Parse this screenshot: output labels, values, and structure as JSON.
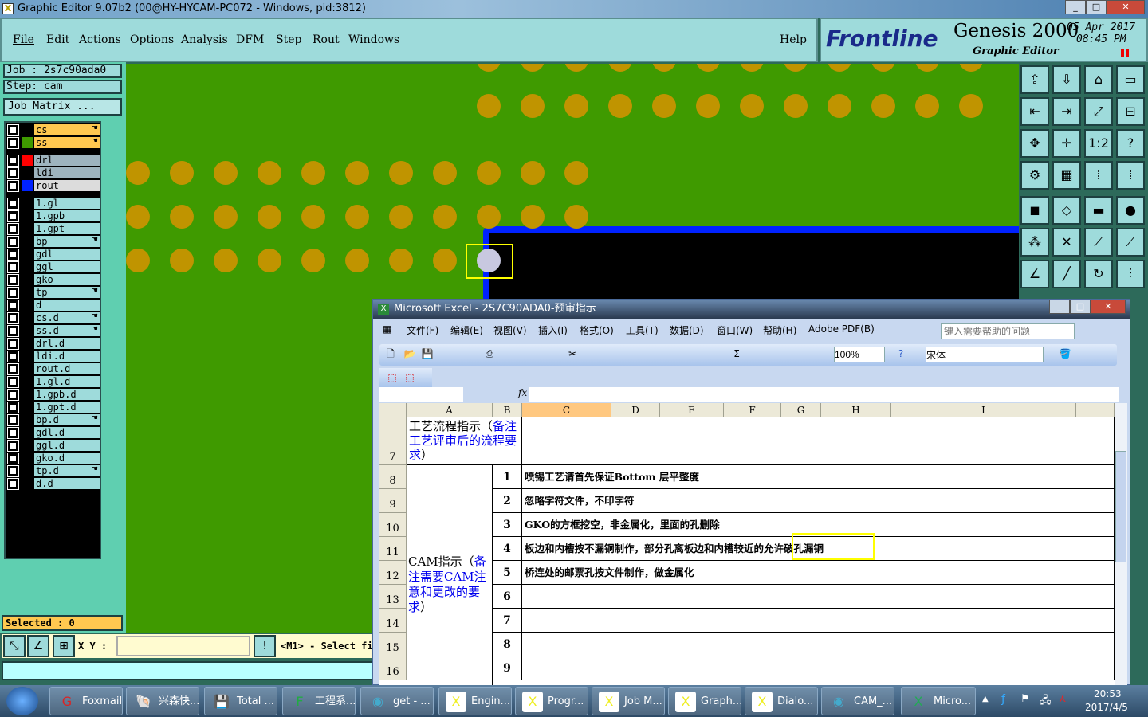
{
  "window": {
    "title": "Graphic Editor 9.07b2 (00@HY-HYCAM-PC072 - Windows, pid:3812)"
  },
  "menu": [
    "File",
    "Edit",
    "Actions",
    "Options",
    "Analysis",
    "DFM",
    "Step",
    "Rout",
    "Windows"
  ],
  "help": "Help",
  "brand": {
    "logo": "Frontline",
    "product": "Genesis 2000",
    "subtitle": "Graphic Editor",
    "date": "05 Apr 2017",
    "time": "08:45 PM"
  },
  "job": {
    "job": "Job : 2s7c90ada0",
    "step": "Step: cam",
    "matrix": "Job Matrix ..."
  },
  "layers": [
    {
      "name": "cs",
      "color": "#000000",
      "bg": "#ffc850",
      "hand": true,
      "group": 0
    },
    {
      "name": "ss",
      "color": "#3f9a00",
      "bg": "#ffc850",
      "hand": true,
      "group": 0
    },
    {
      "name": "drl",
      "color": "#ff0000",
      "bg": "#9eb4be",
      "hand": false,
      "group": 1
    },
    {
      "name": "ldi",
      "color": "#000000",
      "bg": "#9eb4be",
      "hand": false,
      "group": 1
    },
    {
      "name": "rout",
      "color": "#0022ff",
      "bg": "#dcdcdc",
      "hand": false,
      "group": 1
    },
    {
      "name": "1.gl",
      "hand": false,
      "group": 2
    },
    {
      "name": "1.gpb",
      "hand": false,
      "group": 2
    },
    {
      "name": "1.gpt",
      "hand": false,
      "group": 2
    },
    {
      "name": "bp",
      "hand": true,
      "group": 2
    },
    {
      "name": "gdl",
      "hand": false,
      "group": 2
    },
    {
      "name": "ggl",
      "hand": false,
      "group": 2
    },
    {
      "name": "gko",
      "hand": false,
      "group": 2
    },
    {
      "name": "tp",
      "hand": true,
      "group": 2
    },
    {
      "name": "d",
      "hand": false,
      "group": 2
    },
    {
      "name": "cs.d",
      "hand": true,
      "group": 2
    },
    {
      "name": "ss.d",
      "hand": true,
      "group": 2
    },
    {
      "name": "drl.d",
      "hand": false,
      "group": 2
    },
    {
      "name": "ldi.d",
      "hand": false,
      "group": 2
    },
    {
      "name": "rout.d",
      "hand": false,
      "group": 2
    },
    {
      "name": "1.gl.d",
      "hand": false,
      "group": 2
    },
    {
      "name": "1.gpb.d",
      "hand": false,
      "group": 2
    },
    {
      "name": "1.gpt.d",
      "hand": false,
      "group": 2
    },
    {
      "name": "bp.d",
      "hand": true,
      "group": 2
    },
    {
      "name": "gdl.d",
      "hand": false,
      "group": 2
    },
    {
      "name": "ggl.d",
      "hand": false,
      "group": 2
    },
    {
      "name": "gko.d",
      "hand": false,
      "group": 2
    },
    {
      "name": "tp.d",
      "hand": true,
      "group": 2
    },
    {
      "name": "d.d",
      "hand": false,
      "group": 2
    }
  ],
  "selected": "Selected : 0",
  "xy_label": "X Y :",
  "prompt": "<M1> - Select fi",
  "excel": {
    "title": "Microsoft Excel - 2S7C90ADA0-预审指示",
    "menu": [
      "文件(F)",
      "编辑(E)",
      "视图(V)",
      "插入(I)",
      "格式(O)",
      "工具(T)",
      "数据(D)",
      "窗口(W)",
      "帮助(H)",
      "Adobe PDF(B)"
    ],
    "help_placeholder": "键入需要帮助的问题",
    "zoom": "100%",
    "font": "宋体",
    "fx": "fx",
    "columns": [
      "A",
      "B",
      "C",
      "D",
      "E",
      "F",
      "G",
      "H",
      "I"
    ],
    "rows": [
      "7",
      "8",
      "9",
      "10",
      "11",
      "12",
      "13",
      "14",
      "15",
      "16"
    ],
    "a7_black": "工艺流程指示（",
    "a7_blue": "备注工艺评审后的流程要求",
    "a7_end": "）",
    "cam_black": "CAM指示（",
    "cam_blue": "备注需要CAM注意和更改的要求",
    "cam_end": "）",
    "items": [
      {
        "n": "1",
        "text": "喷锡工艺请首先保证Bottom 层平整度"
      },
      {
        "n": "2",
        "text": "忽略字符文件，不印字符"
      },
      {
        "n": "3",
        "text": "GKO的方框挖空，非金属化，里面的孔删除"
      },
      {
        "n": "4",
        "text": "板边和内槽按不漏铜制作，部分孔离板边和内槽较近的允许破孔漏铜"
      },
      {
        "n": "5",
        "text": "桥连处的邮票孔按文件制作，做金属化"
      },
      {
        "n": "6",
        "text": ""
      },
      {
        "n": "7",
        "text": ""
      },
      {
        "n": "8",
        "text": ""
      },
      {
        "n": "9",
        "text": ""
      }
    ]
  },
  "taskbar": {
    "items": [
      "Foxmail",
      "兴森快...",
      "Total ...",
      "工程系...",
      "get - ...",
      "Engin...",
      "Progr...",
      "Job M...",
      "Graph...",
      "Dialo...",
      "CAM_...",
      "Micro..."
    ],
    "time": "20:53",
    "date": "2017/4/5"
  }
}
